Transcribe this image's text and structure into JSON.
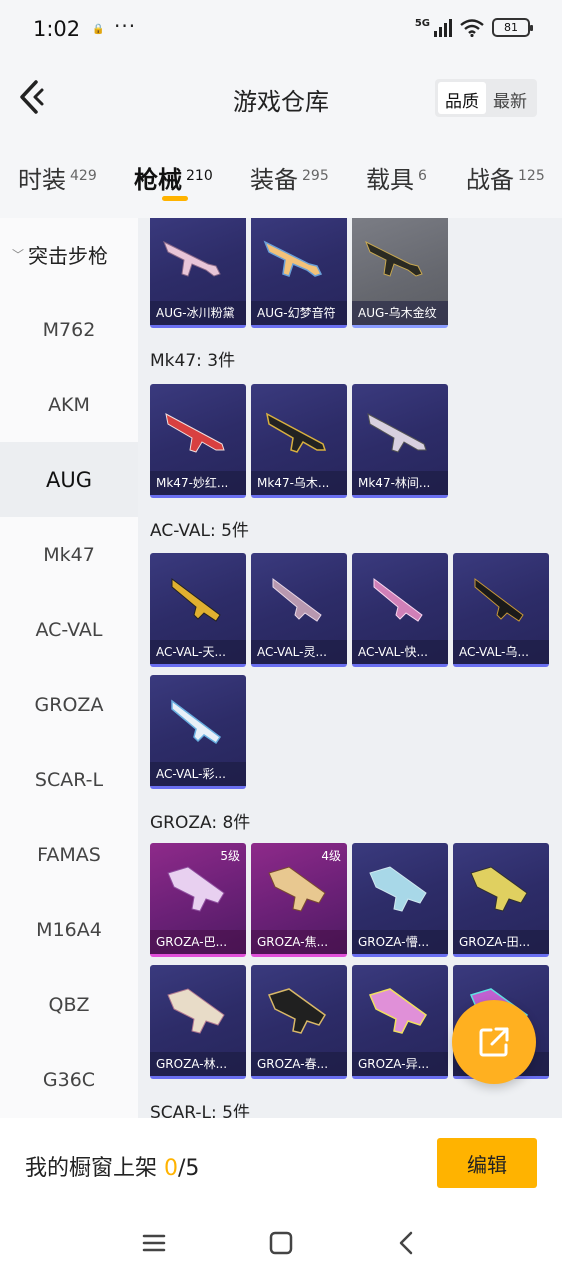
{
  "status": {
    "time": "1:02",
    "lock_glyph": "🔒",
    "dots": "···",
    "network": "5G",
    "battery": "81"
  },
  "header": {
    "title": "游戏仓库",
    "sort": {
      "quality": "品质",
      "newest": "最新"
    }
  },
  "tabs": [
    {
      "label": "时装",
      "count": "429"
    },
    {
      "label": "枪械",
      "count": "210"
    },
    {
      "label": "装备",
      "count": "295"
    },
    {
      "label": "载具",
      "count": "6"
    },
    {
      "label": "战备",
      "count": "125"
    }
  ],
  "sidebar": {
    "section": "突击步枪",
    "items": [
      "M762",
      "AKM",
      "AUG",
      "Mk47",
      "AC-VAL",
      "GROZA",
      "SCAR-L",
      "FAMAS",
      "M16A4",
      "QBZ",
      "G36C"
    ]
  },
  "groups": {
    "aug": {
      "cards": [
        "AUG-冰川粉黛",
        "AUG-幻梦音符",
        "AUG-乌木金纹"
      ]
    },
    "mk47": {
      "title": "Mk47: 3件",
      "cards": [
        "Mk47-妙红...",
        "Mk47-乌木...",
        "Mk47-林间..."
      ]
    },
    "acval": {
      "title": "AC-VAL: 5件",
      "cards": [
        "AC-VAL-天...",
        "AC-VAL-灵...",
        "AC-VAL-快...",
        "AC-VAL-乌...",
        "AC-VAL-彩..."
      ]
    },
    "groza": {
      "title": "GROZA: 8件",
      "cards": [
        "GROZA-巴...",
        "GROZA-焦...",
        "GROZA-懵...",
        "GROZA-田...",
        "GROZA-林...",
        "GROZA-春...",
        "GROZA-异...",
        ""
      ],
      "levels": [
        "5级",
        "4级"
      ]
    },
    "scarl": {
      "title": "SCAR-L: 5件"
    }
  },
  "bottom": {
    "prefix": "我的橱窗上架 ",
    "current": "0",
    "suffix": "/5",
    "edit": "编辑"
  },
  "colors": {
    "accent": "#ffb300",
    "card_blue": "#2d2c68",
    "card_pink": "#6d2178"
  },
  "icons": {
    "back": "chevron-left-icon",
    "share": "share-external-icon",
    "menu": "menu-icon",
    "home": "home-square-icon",
    "nav_back": "nav-back-icon"
  }
}
